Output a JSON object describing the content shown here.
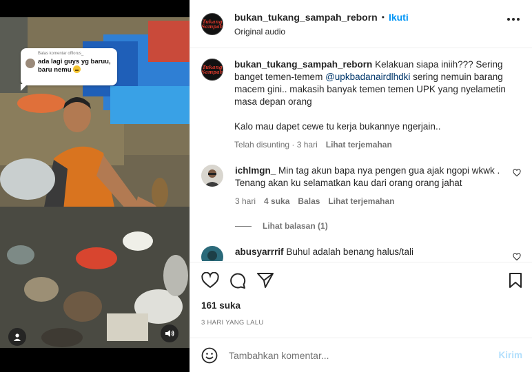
{
  "media": {
    "reply_bubble": {
      "header": "Balas komentar offlorus_",
      "text": "ada lagi guys yg baruu, baru nemu"
    },
    "user_icon": "person-icon",
    "sound_icon": "speaker-icon"
  },
  "header": {
    "logo_line1": "Tukang",
    "logo_line2": "Sampah",
    "username": "bukan_tukang_sampah_reborn",
    "separator": "•",
    "follow_label": "Ikuti",
    "audio": "Original audio",
    "more_icon": "more-options-icon"
  },
  "caption": {
    "username": "bukan_tukang_sampah_reborn",
    "text_before_mention": "Kelakuan siapa iniih??? Sering banget temen-temem",
    "mention": "@upkbadanairdlhdki",
    "text_after_mention": "sering nemuin barang macem gini.. makasih banyak temen temen UPK yang nyelametin masa depan orang",
    "text_second": "Kalo mau dapet cewe tu kerja bukannye ngerjain..",
    "edited": "Telah disunting · 3 hari",
    "translate": "Lihat terjemahan"
  },
  "comments": [
    {
      "username": "ichlmgn_",
      "text": "Min tag akun bapa nya pengen gua ajak ngopi wkwk . Tenang akan ku selamatkan kau dari orang orang jahat",
      "time": "3 hari",
      "likes": "4 suka",
      "reply": "Balas",
      "translate": "Lihat terjemahan",
      "view_replies": "Lihat balasan (1)"
    },
    {
      "username": "abusyarrrif",
      "text": "Buhul adalah benang halus/tali"
    }
  ],
  "actions": {
    "likes": "161 suka",
    "date": "3 HARI YANG LALU"
  },
  "composer": {
    "placeholder": "Tambahkan komentar...",
    "post_label": "Kirim"
  },
  "colors": {
    "accent": "#0095f6",
    "post_disabled": "#b2dffc",
    "mention": "#00376b",
    "muted": "#737373"
  }
}
